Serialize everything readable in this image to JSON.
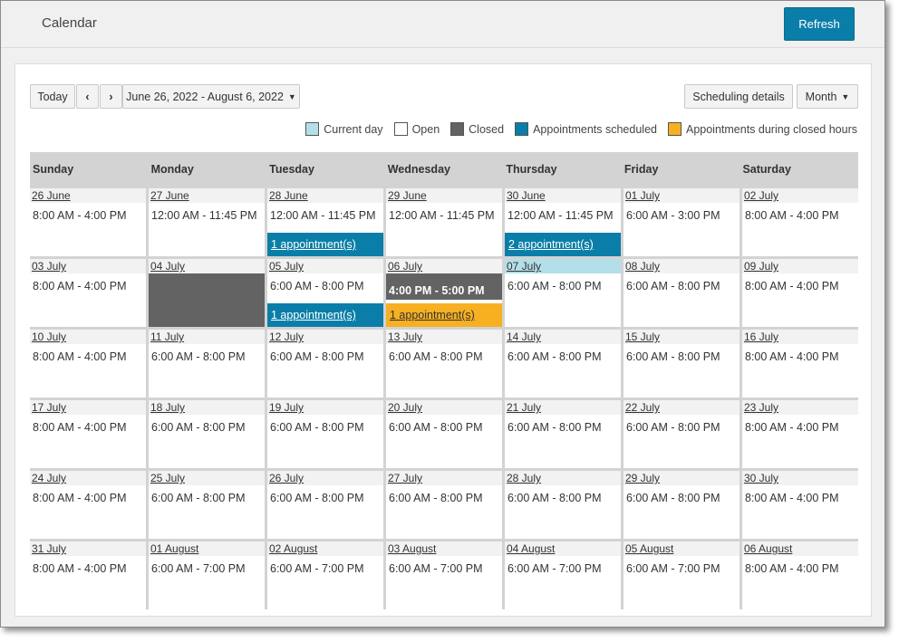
{
  "header": {
    "title": "Calendar",
    "refresh_label": "Refresh"
  },
  "toolbar": {
    "today_label": "Today",
    "prev_label": "‹",
    "next_label": "›",
    "date_range": "June 26, 2022 - August 6, 2022",
    "scheduling_details_label": "Scheduling details",
    "view_label": "Month"
  },
  "legend": [
    {
      "label": "Current day",
      "color": "#b3dfea"
    },
    {
      "label": "Open",
      "color": "#ffffff"
    },
    {
      "label": "Closed",
      "color": "#636363"
    },
    {
      "label": "Appointments scheduled",
      "color": "#0a7ea8"
    },
    {
      "label": "Appointments during closed hours",
      "color": "#f6b022"
    }
  ],
  "days_of_week": [
    "Sunday",
    "Monday",
    "Tuesday",
    "Wednesday",
    "Thursday",
    "Friday",
    "Saturday"
  ],
  "weeks": [
    [
      {
        "date": "26 June",
        "hours": "8:00 AM - 4:00 PM"
      },
      {
        "date": "27 June",
        "hours": "12:00 AM - 11:45 PM"
      },
      {
        "date": "28 June",
        "hours": "12:00 AM - 11:45 PM",
        "appointments": "1 appointment(s)"
      },
      {
        "date": "29 June",
        "hours": "12:00 AM - 11:45 PM"
      },
      {
        "date": "30 June",
        "hours": "12:00 AM - 11:45 PM",
        "appointments": "2 appointment(s)"
      },
      {
        "date": "01 July",
        "hours": "6:00 AM - 3:00 PM"
      },
      {
        "date": "02 July",
        "hours": "8:00 AM - 4:00 PM"
      }
    ],
    [
      {
        "date": "03 July",
        "hours": "8:00 AM - 4:00 PM"
      },
      {
        "date": "04 July",
        "hours": "",
        "closed": true
      },
      {
        "date": "05 July",
        "hours": "6:00 AM - 8:00 PM",
        "appointments": "1 appointment(s)"
      },
      {
        "date": "06 July",
        "hours": "4:00 PM - 5:00 PM",
        "closed_hours": true,
        "after_hours_appointments": "1 appointment(s)"
      },
      {
        "date": "07 July",
        "hours": "6:00 AM - 8:00 PM",
        "current": true
      },
      {
        "date": "08 July",
        "hours": "6:00 AM - 8:00 PM"
      },
      {
        "date": "09 July",
        "hours": "8:00 AM - 4:00 PM"
      }
    ],
    [
      {
        "date": "10 July",
        "hours": "8:00 AM - 4:00 PM"
      },
      {
        "date": "11 July",
        "hours": "6:00 AM - 8:00 PM"
      },
      {
        "date": "12 July",
        "hours": "6:00 AM - 8:00 PM"
      },
      {
        "date": "13 July",
        "hours": "6:00 AM - 8:00 PM"
      },
      {
        "date": "14 July",
        "hours": "6:00 AM - 8:00 PM"
      },
      {
        "date": "15 July",
        "hours": "6:00 AM - 8:00 PM"
      },
      {
        "date": "16 July",
        "hours": "8:00 AM - 4:00 PM"
      }
    ],
    [
      {
        "date": "17 July",
        "hours": "8:00 AM - 4:00 PM"
      },
      {
        "date": "18 July",
        "hours": "6:00 AM - 8:00 PM"
      },
      {
        "date": "19 July",
        "hours": "6:00 AM - 8:00 PM"
      },
      {
        "date": "20 July",
        "hours": "6:00 AM - 8:00 PM"
      },
      {
        "date": "21 July",
        "hours": "6:00 AM - 8:00 PM"
      },
      {
        "date": "22 July",
        "hours": "6:00 AM - 8:00 PM"
      },
      {
        "date": "23 July",
        "hours": "8:00 AM - 4:00 PM"
      }
    ],
    [
      {
        "date": "24 July",
        "hours": "8:00 AM - 4:00 PM"
      },
      {
        "date": "25 July",
        "hours": "6:00 AM - 8:00 PM"
      },
      {
        "date": "26 July",
        "hours": "6:00 AM - 8:00 PM"
      },
      {
        "date": "27 July",
        "hours": "6:00 AM - 8:00 PM"
      },
      {
        "date": "28 July",
        "hours": "6:00 AM - 8:00 PM"
      },
      {
        "date": "29 July",
        "hours": "6:00 AM - 8:00 PM"
      },
      {
        "date": "30 July",
        "hours": "8:00 AM - 4:00 PM"
      }
    ],
    [
      {
        "date": "31 July",
        "hours": "8:00 AM - 4:00 PM"
      },
      {
        "date": "01 August",
        "hours": "6:00 AM - 7:00 PM"
      },
      {
        "date": "02 August",
        "hours": "6:00 AM - 7:00 PM"
      },
      {
        "date": "03 August",
        "hours": "6:00 AM - 7:00 PM"
      },
      {
        "date": "04 August",
        "hours": "6:00 AM - 7:00 PM"
      },
      {
        "date": "05 August",
        "hours": "6:00 AM - 7:00 PM"
      },
      {
        "date": "06 August",
        "hours": "8:00 AM - 4:00 PM"
      }
    ]
  ]
}
